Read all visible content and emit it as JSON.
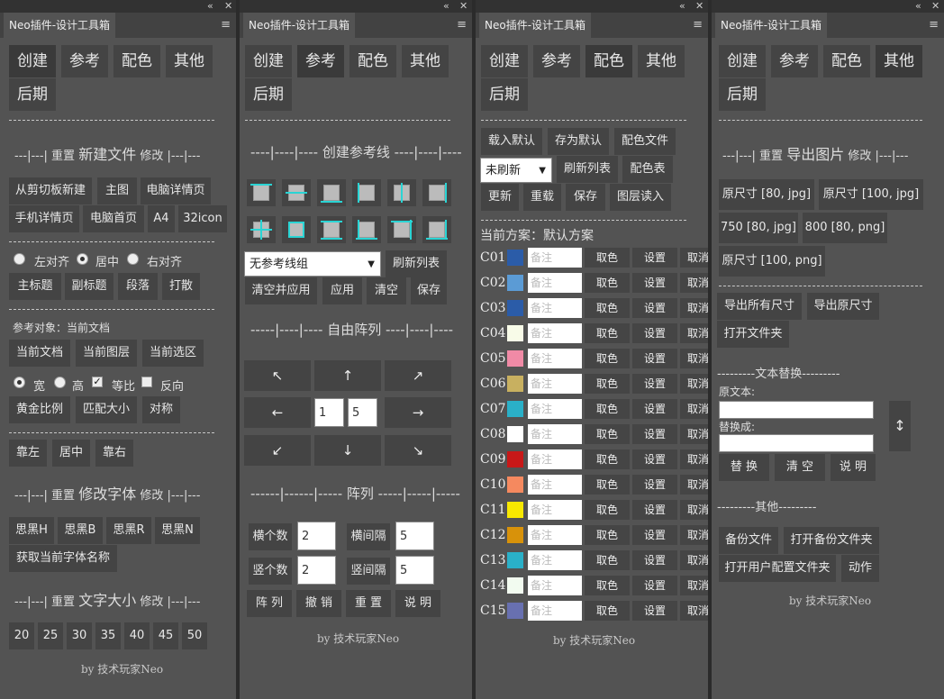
{
  "panel_title": "Neo插件-设计工具箱",
  "win_controls": {
    "collapse": "«",
    "close": "✕",
    "menu": "≡"
  },
  "tabs": [
    "创建",
    "参考",
    "配色",
    "其他",
    "后期"
  ],
  "footer": "by 技术玩家Neo",
  "create": {
    "sec_new_file": {
      "prefix": "---|---|",
      "reset": "重置",
      "title": "新建文件",
      "edit": "修改",
      "suffix": "|---|---"
    },
    "new_file_buttons": [
      "从剪切板新建",
      "主图",
      "电脑详情页",
      "手机详情页",
      "电脑首页",
      "A4",
      "32icon"
    ],
    "align_radios": [
      "左对齐",
      "居中",
      "右对齐"
    ],
    "text_buttons": [
      "主标题",
      "副标题",
      "段落",
      "打散"
    ],
    "ref_label": "参考对象：当前文档",
    "ref_buttons": [
      "当前文档",
      "当前图层",
      "当前选区"
    ],
    "dim_options": [
      "宽",
      "高",
      "等比",
      "反向"
    ],
    "ratio_buttons": [
      "黄金比例",
      "匹配大小",
      "对称"
    ],
    "pos_buttons": [
      "靠左",
      "居中",
      "靠右"
    ],
    "sec_font": {
      "prefix": "---|---|",
      "reset": "重置",
      "title": "修改字体",
      "edit": "修改",
      "suffix": "|---|---"
    },
    "font_buttons": [
      "思黑H",
      "思黑B",
      "思黑R",
      "思黑N"
    ],
    "font_name_button": "获取当前字体名称",
    "sec_size": {
      "prefix": "---|---|",
      "reset": "重置",
      "title": "文字大小",
      "edit": "修改",
      "suffix": "|---|---"
    },
    "size_buttons": [
      "20",
      "25",
      "30",
      "35",
      "40",
      "45",
      "50"
    ]
  },
  "reference": {
    "sec_guides": "----|----|---- 创建参考线 ----|----|----",
    "guide_select": "无参考线组",
    "refresh_button": "刷新列表",
    "guide_buttons": [
      "清空并应用",
      "应用",
      "清空",
      "保存"
    ],
    "sec_array": "-----|----|---- 自由阵列 ----|----|----",
    "arrows": [
      "↖",
      "↑",
      "↗",
      "←",
      "→",
      "↙",
      "↓",
      "↘"
    ],
    "array_inputs": [
      "1",
      "5"
    ],
    "sec_grid": "------|------|----- 阵列 -----|-----|-----",
    "grid_fields": [
      {
        "label": "横个数",
        "value": "2"
      },
      {
        "label": "横间隔",
        "value": "5"
      },
      {
        "label": "竖个数",
        "value": "2"
      },
      {
        "label": "竖间隔",
        "value": "5"
      }
    ],
    "grid_buttons": [
      "阵 列",
      "撤 销",
      "重 置",
      "说 明"
    ]
  },
  "colors": {
    "top_buttons": [
      "载入默认",
      "存为默认",
      "配色文件"
    ],
    "refresh_select": "未刷新",
    "mid_buttons": [
      "刷新列表",
      "配色表"
    ],
    "bottom_buttons": [
      "更新",
      "重载",
      "保存",
      "图层读入"
    ],
    "current_scheme": "当前方案：默认方案",
    "input_placeholder": "备注",
    "row_buttons": [
      "取色",
      "设置",
      "取消"
    ],
    "rows": [
      {
        "id": "C01",
        "color": "#2b5ca8"
      },
      {
        "id": "C02",
        "color": "#5b9bd5"
      },
      {
        "id": "C03",
        "color": "#2b5ca8"
      },
      {
        "id": "C04",
        "color": "#f8fbe8"
      },
      {
        "id": "C05",
        "color": "#f08aa6"
      },
      {
        "id": "C06",
        "color": "#c8b060"
      },
      {
        "id": "C07",
        "color": "#2ab0c8"
      },
      {
        "id": "C08",
        "color": "#ffffff"
      },
      {
        "id": "C09",
        "color": "#c81818"
      },
      {
        "id": "C10",
        "color": "#f5895f"
      },
      {
        "id": "C11",
        "color": "#f8e800"
      },
      {
        "id": "C12",
        "color": "#d8920a"
      },
      {
        "id": "C13",
        "color": "#2ab0c8"
      },
      {
        "id": "C14",
        "color": "#f2fbf0"
      },
      {
        "id": "C15",
        "color": "#6870b0"
      }
    ]
  },
  "other": {
    "sec_export": {
      "prefix": "---|---|",
      "reset": "重置",
      "title": "导出图片",
      "edit": "修改",
      "suffix": "|---|---"
    },
    "export_buttons": [
      "原尺寸 [80, jpg]",
      "原尺寸 [100, jpg]",
      "750 [80, jpg]",
      "800 [80, png]",
      "原尺寸 [100, png]"
    ],
    "export_all_buttons": [
      "导出所有尺寸",
      "导出原尺寸",
      "打开文件夹"
    ],
    "sec_replace": "---------文本替换---------",
    "original_label": "原文本:",
    "replace_label": "替换成:",
    "swap_icon": "↕",
    "replace_buttons": [
      "替 换",
      "清 空",
      "说 明"
    ],
    "sec_other": "---------其他---------",
    "other_buttons": [
      "备份文件",
      "打开备份文件夹",
      "打开用户配置文件夹",
      "动作"
    ]
  }
}
